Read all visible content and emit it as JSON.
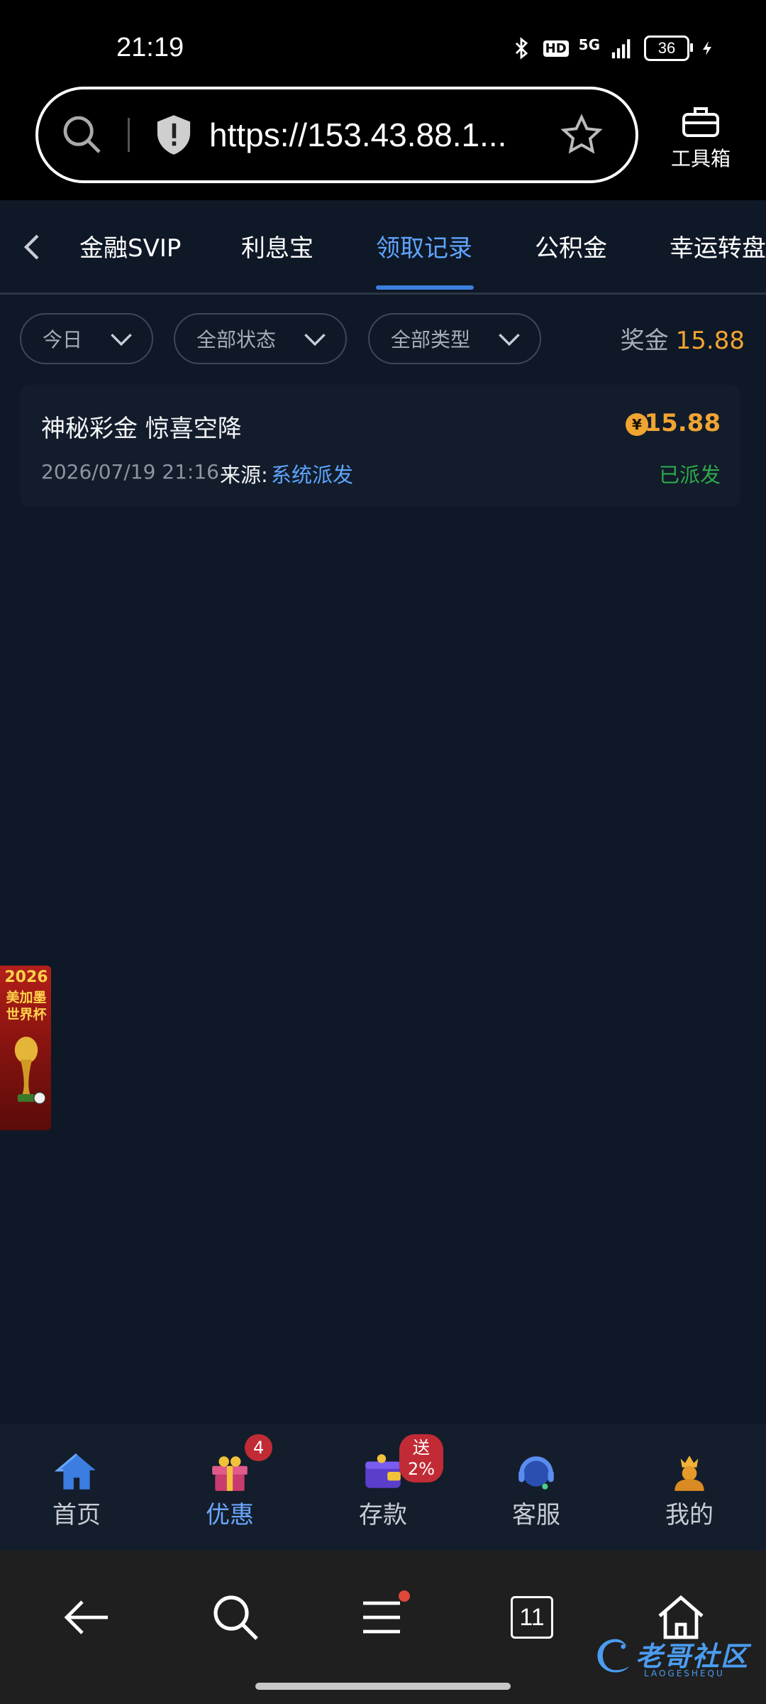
{
  "status_bar": {
    "time": "21:19",
    "network": "5G",
    "hd": "HD",
    "battery": "36",
    "icons": [
      "bluetooth-icon",
      "hd-icon",
      "5g-icon",
      "signal-icon",
      "battery-icon",
      "charging-icon"
    ]
  },
  "browser": {
    "url": "https://153.43.88.1...",
    "toolbox_label": "工具箱"
  },
  "tabs": {
    "items": [
      {
        "label": "金融SVIP",
        "active": false
      },
      {
        "label": "利息宝",
        "active": false
      },
      {
        "label": "领取记录",
        "active": true
      },
      {
        "label": "公积金",
        "active": false
      },
      {
        "label": "幸运转盘",
        "active": false
      }
    ]
  },
  "filters": {
    "date": "今日",
    "status": "全部状态",
    "type": "全部类型",
    "bonus_label": "奖金",
    "bonus_amount": "15.88"
  },
  "records": [
    {
      "title": "神秘彩金 惊喜空降",
      "coin_symbol": "¥",
      "amount": "15.88",
      "date": "2026/07/19 21:16",
      "source_label": "来源:",
      "source": "系统派发",
      "status": "已派发"
    }
  ],
  "float_banner": {
    "line1": "2026",
    "line2": "美加墨",
    "line3": "世界杯"
  },
  "app_nav": {
    "items": [
      {
        "label": "首页",
        "icon": "home-icon",
        "active": false
      },
      {
        "label": "优惠",
        "icon": "gift-icon",
        "active": true,
        "badge": "4"
      },
      {
        "label": "存款",
        "icon": "wallet-icon",
        "active": false,
        "badge": "送2%"
      },
      {
        "label": "客服",
        "icon": "headset-icon",
        "active": false
      },
      {
        "label": "我的",
        "icon": "profile-icon",
        "active": false
      }
    ]
  },
  "system_nav": {
    "tabs_count": "11"
  },
  "watermark": {
    "text": "老哥社区",
    "sub": "LAOGESHEQU"
  },
  "colors": {
    "background": "#0f1826",
    "accent": "#5ea5ff",
    "amount": "#f0a431",
    "success": "#2ea84a",
    "badge": "#c12b36"
  }
}
